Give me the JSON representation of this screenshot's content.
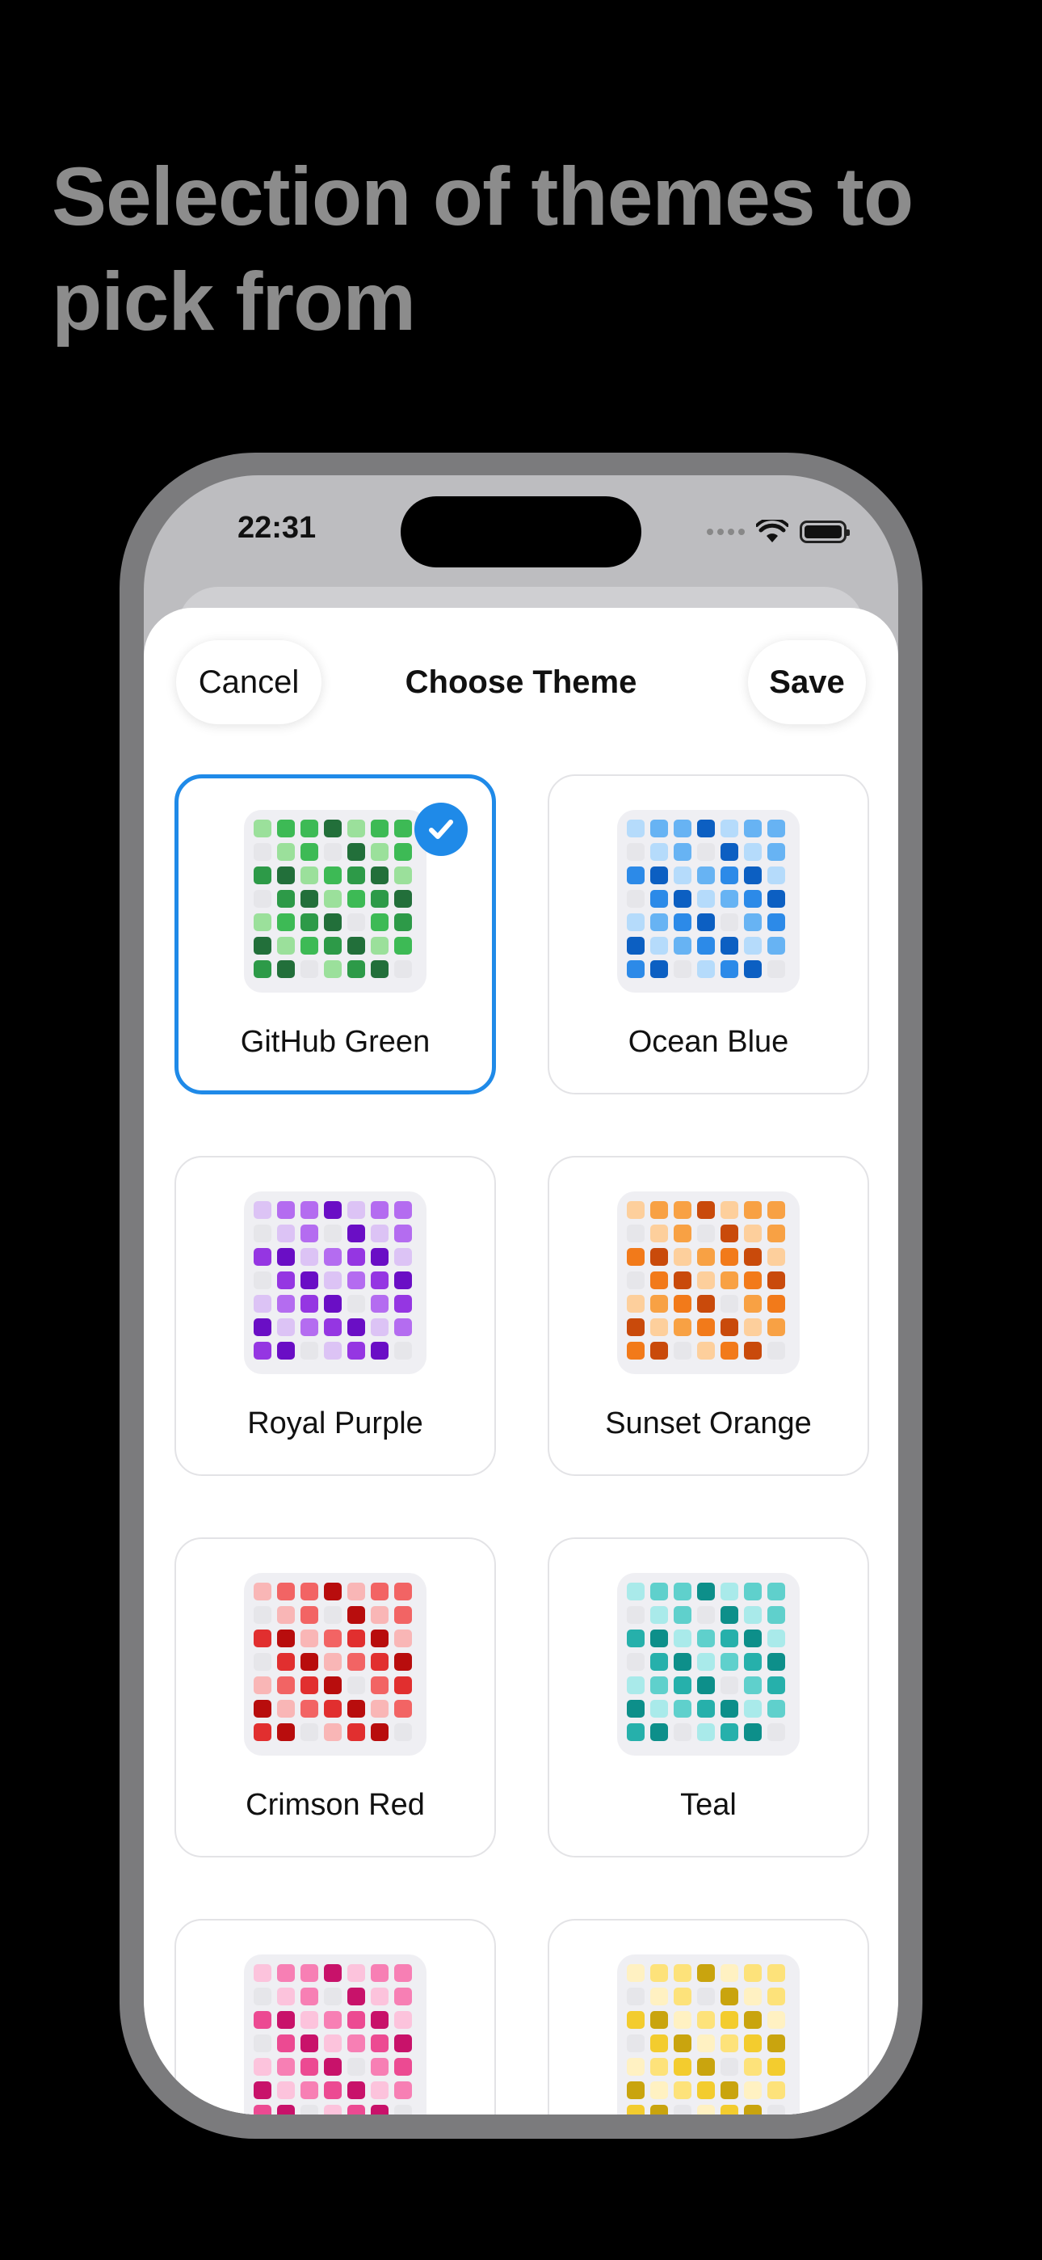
{
  "headline": {
    "line1": "Selection of themes to",
    "line2": "pick from"
  },
  "status_bar": {
    "time": "22:31"
  },
  "sheet": {
    "title": "Choose Theme",
    "cancel_label": "Cancel",
    "save_label": "Save"
  },
  "themes": [
    {
      "name": "GitHub Green",
      "selected": true,
      "colors": [
        "#9be09b",
        "#3dba55",
        "#2d9a48",
        "#226f3a"
      ]
    },
    {
      "name": "Ocean Blue",
      "selected": false,
      "colors": [
        "#b5dbfb",
        "#67b3f3",
        "#2c8ae8",
        "#0c5fc2"
      ]
    },
    {
      "name": "Royal Purple",
      "selected": false,
      "colors": [
        "#dcc3f5",
        "#b46cf0",
        "#9536e2",
        "#6a0ec5"
      ]
    },
    {
      "name": "Sunset Orange",
      "selected": false,
      "colors": [
        "#fdcf9c",
        "#f8a144",
        "#f27a1a",
        "#c94a0b"
      ]
    },
    {
      "name": "Crimson Red",
      "selected": false,
      "colors": [
        "#f9b6b6",
        "#f26464",
        "#e12f2f",
        "#b80d0d"
      ]
    },
    {
      "name": "Teal",
      "selected": false,
      "colors": [
        "#a9eaea",
        "#5fd0cc",
        "#26b0ab",
        "#0d8f8a"
      ]
    },
    {
      "name": "",
      "selected": false,
      "colors": [
        "#fcc3dc",
        "#f77fb4",
        "#ec4a92",
        "#c8126a"
      ]
    },
    {
      "name": "",
      "selected": false,
      "colors": [
        "#fff1c2",
        "#fde27a",
        "#f3cc2e",
        "#c9a40e"
      ]
    }
  ],
  "selection_color": "#1f8ae8"
}
